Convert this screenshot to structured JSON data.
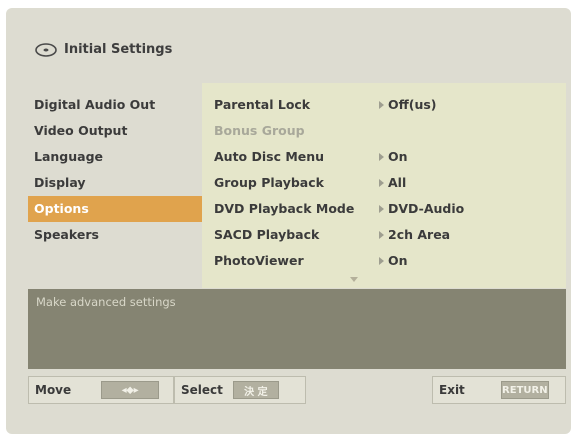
{
  "title": "Initial Settings",
  "title_icon": "disc-icon",
  "left_menu": [
    {
      "label": "Digital Audio Out",
      "active": false
    },
    {
      "label": "Video Output",
      "active": false
    },
    {
      "label": "Language",
      "active": false
    },
    {
      "label": "Display",
      "active": false
    },
    {
      "label": "Options",
      "active": true
    },
    {
      "label": "Speakers",
      "active": false
    }
  ],
  "options": [
    {
      "label": "Parental Lock",
      "value": "Off(us)",
      "disabled": false
    },
    {
      "label": "Bonus Group",
      "value": "",
      "disabled": true
    },
    {
      "label": "Auto Disc Menu",
      "value": "On",
      "disabled": false
    },
    {
      "label": "Group Playback",
      "value": "All",
      "disabled": false
    },
    {
      "label": "DVD Playback Mode",
      "value": "DVD-Audio",
      "disabled": false
    },
    {
      "label": "SACD Playback",
      "value": "2ch Area",
      "disabled": false
    },
    {
      "label": "PhotoViewer",
      "value": "On",
      "disabled": false
    }
  ],
  "description": "Make advanced settings",
  "bottom_bar": {
    "move_label": "Move",
    "move_key": "◂⬥▸",
    "select_label": "Select",
    "select_key": "決 定",
    "exit_label": "Exit",
    "exit_key": "RETURN"
  },
  "colors": {
    "background": "#dddcd1",
    "options_panel": "#e5e6ca",
    "active_highlight": "#e0a34d",
    "description_box": "#858472"
  }
}
